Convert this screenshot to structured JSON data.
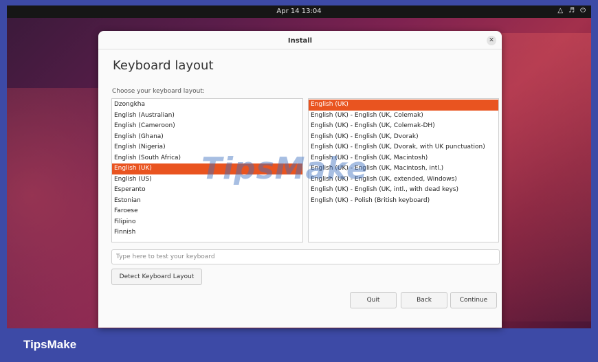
{
  "topbar": {
    "clock": "Apr 14 13:04",
    "tray_icons": [
      "network-icon",
      "volume-icon",
      "power-icon"
    ]
  },
  "dialog": {
    "title": "Install",
    "close_icon": "close-icon",
    "heading": "Keyboard layout",
    "choose_label": "Choose your keyboard layout:",
    "layouts": [
      "Dzongkha",
      "English (Australian)",
      "English (Cameroon)",
      "English (Ghana)",
      "English (Nigeria)",
      "English (South Africa)",
      "English (UK)",
      "English (US)",
      "Esperanto",
      "Estonian",
      "Faroese",
      "Filipino",
      "Finnish"
    ],
    "selected_layout": "English (UK)",
    "variants": [
      "English (UK)",
      "English (UK) - English (UK, Colemak)",
      "English (UK) - English (UK, Colemak-DH)",
      "English (UK) - English (UK, Dvorak)",
      "English (UK) - English (UK, Dvorak, with UK punctuation)",
      "English (UK) - English (UK, Macintosh)",
      "English (UK) - English (UK, Macintosh, intl.)",
      "English (UK) - English (UK, extended, Windows)",
      "English (UK) - English (UK, intl., with dead keys)",
      "English (UK) - Polish (British keyboard)"
    ],
    "selected_variant": "English (UK)",
    "test_placeholder": "Type here to test your keyboard",
    "detect_label": "Detect Keyboard Layout",
    "quit_label": "Quit",
    "back_label": "Back",
    "continue_label": "Continue"
  },
  "watermark": "TipsMake",
  "brand": "TipsMake",
  "colors": {
    "accent": "#e95420",
    "brand_bar": "#3d4aa6",
    "topbar": "#161616"
  }
}
